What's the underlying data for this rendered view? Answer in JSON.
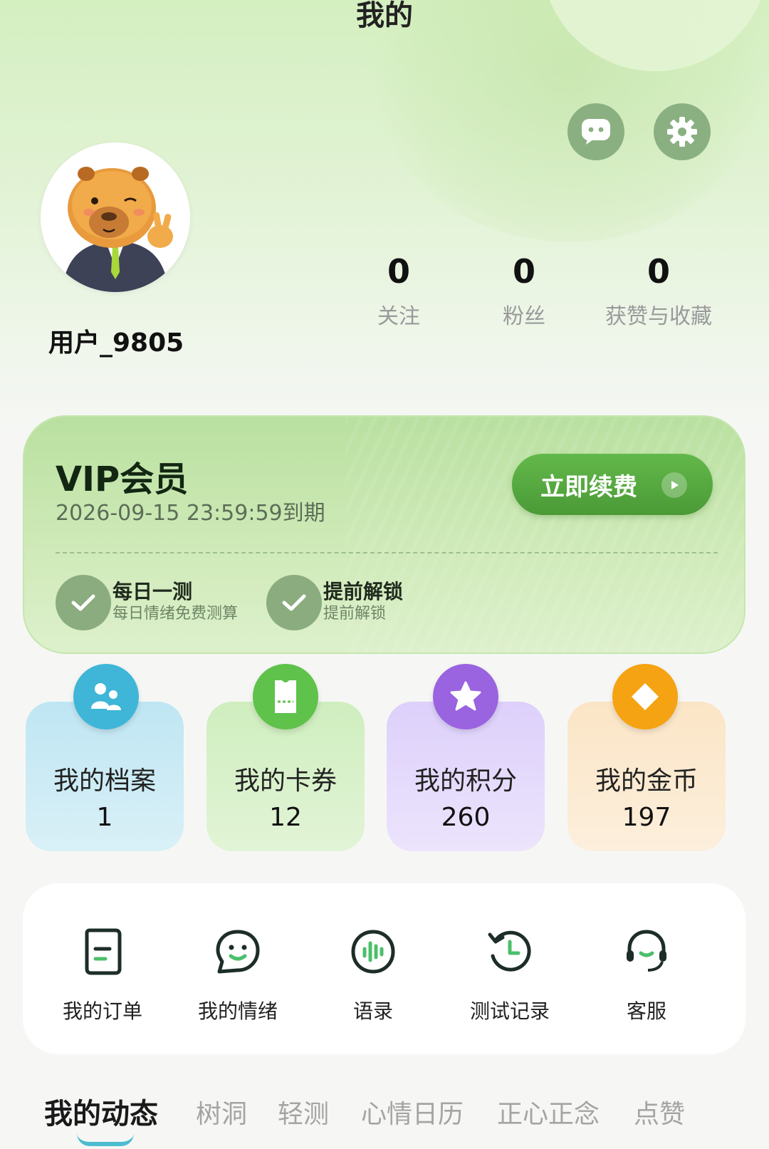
{
  "header": {
    "title": "我的"
  },
  "profile": {
    "username": "用户_9805",
    "stats": [
      {
        "value": "0",
        "label": "关注"
      },
      {
        "value": "0",
        "label": "粉丝"
      },
      {
        "value": "0",
        "label": "获赞与收藏"
      }
    ]
  },
  "vip": {
    "title": "VIP会员",
    "expire": "2026-09-15 23:59:59到期",
    "renew_label": "立即续费",
    "perks": [
      {
        "title": "每日一测",
        "subtitle": "每日情绪免费测算"
      },
      {
        "title": "提前解锁",
        "subtitle": "提前解锁"
      }
    ]
  },
  "cards": [
    {
      "title": "我的档案",
      "value": "1",
      "icon": "people-icon",
      "color": "#3fb6d8"
    },
    {
      "title": "我的卡券",
      "value": "12",
      "icon": "ticket-icon",
      "color": "#5fc24a"
    },
    {
      "title": "我的积分",
      "value": "260",
      "icon": "star-icon",
      "color": "#9a63e0"
    },
    {
      "title": "我的金币",
      "value": "197",
      "icon": "coin-icon",
      "color": "#f5a312"
    }
  ],
  "menu": [
    {
      "label": "我的订单",
      "icon": "order-icon"
    },
    {
      "label": "我的情绪",
      "icon": "smile-chat-icon"
    },
    {
      "label": "语录",
      "icon": "voice-icon"
    },
    {
      "label": "测试记录",
      "icon": "history-icon"
    },
    {
      "label": "客服",
      "icon": "headset-icon"
    }
  ],
  "tabs": [
    "我的动态",
    "树洞",
    "轻测",
    "心情日历",
    "正心正念",
    "点赞"
  ],
  "colors": {
    "accent_green": "#4a9a36",
    "tab_indicator": "#4cbccf"
  }
}
